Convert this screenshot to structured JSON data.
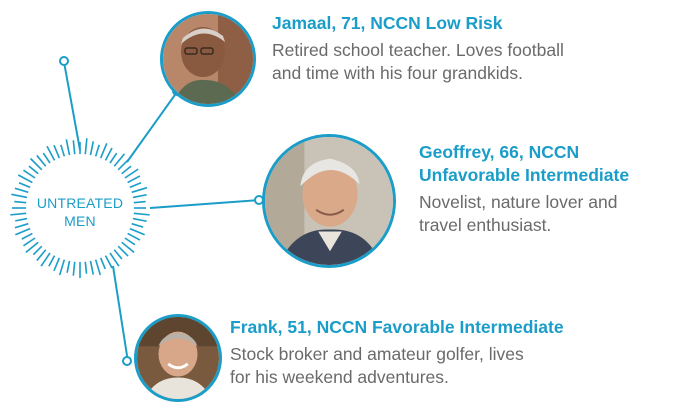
{
  "hub": {
    "label_line1": "UNTREATED",
    "label_line2": "MEN"
  },
  "people": [
    {
      "name": "Jamaal, 71, NCCN Low Risk",
      "desc_line1": "Retired school teacher. Loves football",
      "desc_line2": "and time with his four grandkids."
    },
    {
      "name_line1": "Geoffrey, 66, NCCN",
      "name_line2": "Unfavorable Intermediate",
      "desc_line1": "Novelist, nature lover and",
      "desc_line2": "travel enthusiast."
    },
    {
      "name": "Frank, 51, NCCN Favorable Intermediate",
      "desc_line1": "Stock broker and amateur golfer, lives",
      "desc_line2": "for his weekend adventures."
    }
  ],
  "colors": {
    "accent": "#1a9dc8",
    "body_text": "#6a6a6a"
  },
  "icons": [
    "starburst-hub",
    "person-photo-jamaal",
    "person-photo-geoffrey",
    "person-photo-frank"
  ]
}
